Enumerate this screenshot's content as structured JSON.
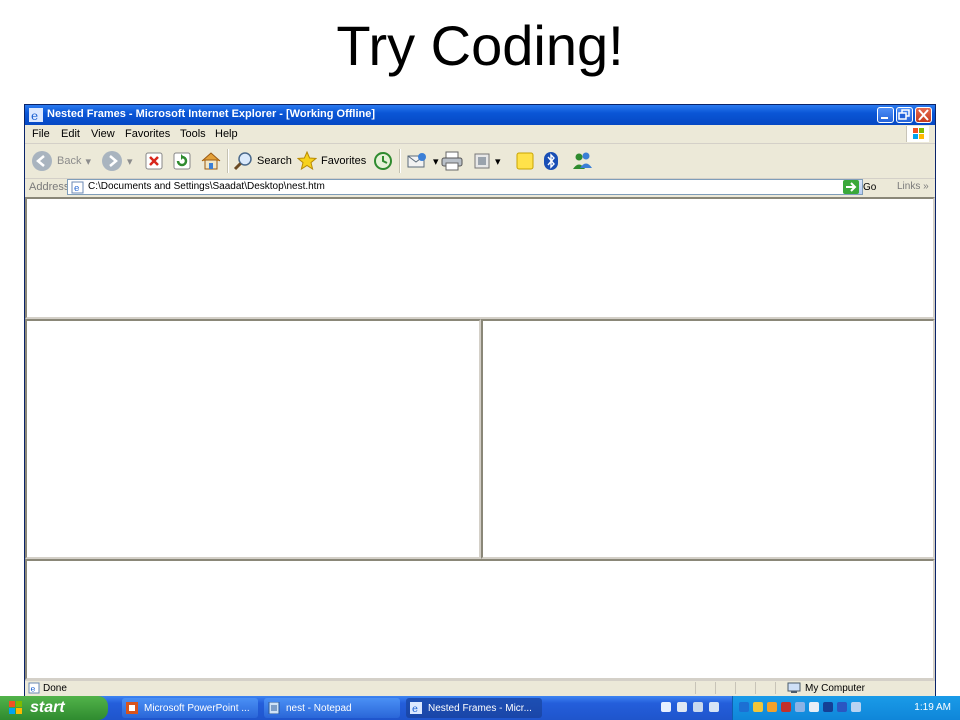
{
  "slide": {
    "title": "Try Coding!"
  },
  "window": {
    "title": "Nested Frames - Microsoft Internet Explorer - [Working Offline]",
    "menu": [
      "File",
      "Edit",
      "View",
      "Favorites",
      "Tools",
      "Help"
    ],
    "toolbar": {
      "back": "Back",
      "search": "Search",
      "favorites": "Favorites"
    },
    "address": {
      "label": "Address",
      "value": "C:\\Documents and Settings\\Saadat\\Desktop\\nest.htm",
      "go": "Go",
      "links": "Links"
    },
    "status": {
      "text": "Done",
      "zone": "My Computer"
    }
  },
  "taskbar": {
    "start": "start",
    "tasks": [
      "Microsoft PowerPoint ...",
      "nest - Notepad",
      "Nested Frames - Micr..."
    ],
    "clock": "1:19 AM"
  },
  "colors": {
    "xp_blue": "#0a56d6",
    "start_green": "#2f8b2f",
    "tray_blue": "#0f86d9"
  }
}
